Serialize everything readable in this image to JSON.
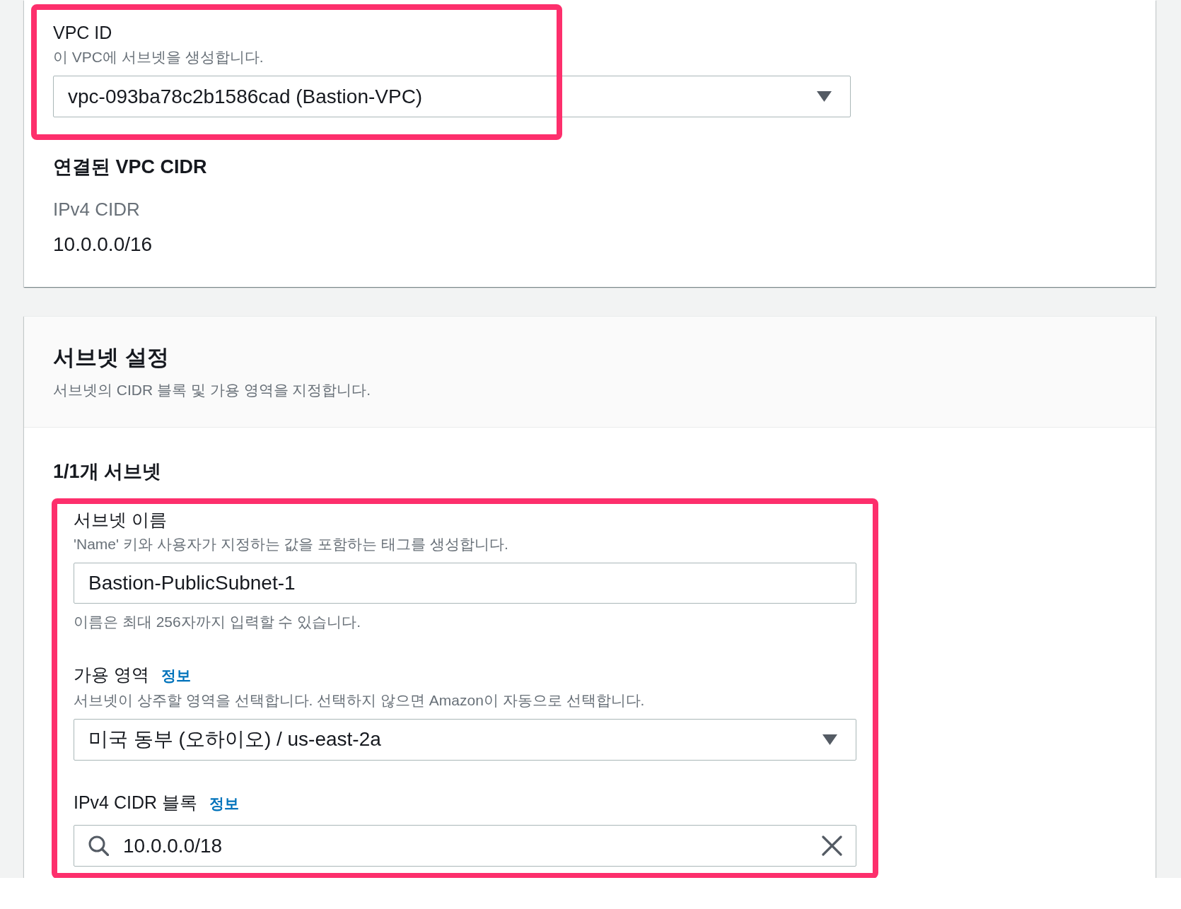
{
  "vpc_card": {
    "vpc_field": {
      "kind": "select",
      "label": "VPC ID",
      "description": "이 VPC에 서브넷을 생성합니다.",
      "value": "vpc-093ba78c2b1586cad (Bastion-VPC)",
      "highlighted": true
    },
    "cidr_section": {
      "title": "연결된 VPC CIDR",
      "label": "IPv4 CIDR",
      "value": "10.0.0.0/16"
    }
  },
  "subnet_settings": {
    "title": "서브넷 설정",
    "description": "서브넷의 CIDR 블록 및 가용 영역을 지정합니다.",
    "subnet_count": "1/1개 서브넷",
    "subnet_form": {
      "highlighted": true,
      "fields": [
        {
          "kind": "text",
          "label": "서브넷 이름",
          "description": "'Name' 키와 사용자가 지정하는 값을 포함하는 태그를 생성합니다.",
          "value": "Bastion-PublicSubnet-1",
          "hint": "이름은 최대 256자까지 입력할 수 있습니다."
        },
        {
          "kind": "select",
          "label": "가용 영역",
          "info_link": "정보",
          "description": "서브넷이 상주할 영역을 선택합니다. 선택하지 않으면 Amazon이 자동으로 선택합니다.",
          "value": "미국 동부 (오하이오) / us-east-2a"
        },
        {
          "kind": "search",
          "label": "IPv4 CIDR 블록",
          "info_link": "정보",
          "value": "10.0.0.0/18"
        }
      ]
    }
  }
}
